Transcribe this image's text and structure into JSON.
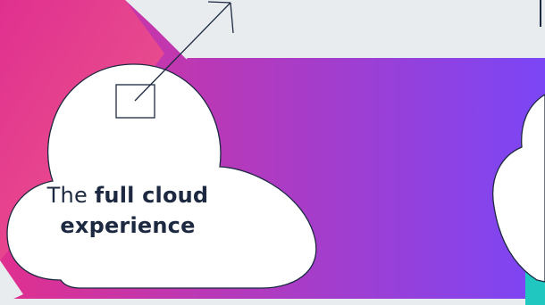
{
  "left_cloud": {
    "prefix": "The",
    "bold_line1": "full cloud",
    "bold_line2": "experience"
  },
  "colors": {
    "background": "#e8ecef",
    "magenta": "#e0308f",
    "purple": "#7b46f6",
    "ink": "#1c2940",
    "teal": "#20c7c0"
  },
  "icons": {
    "corner_graphic": "external-link-arrow-icon"
  }
}
